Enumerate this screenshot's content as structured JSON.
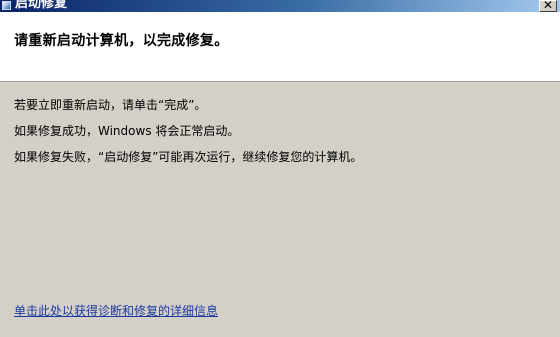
{
  "window": {
    "title": "启动修复",
    "close_glyph": "✕"
  },
  "header": {
    "title": "请重新启动计算机，以完成修复。"
  },
  "body": {
    "lines": [
      "若要立即重新启动，请单击“完成”。",
      "如果修复成功，Windows 将会正常启动。",
      "如果修复失败，“启动修复”可能再次运行，继续修复您的计算机。"
    ]
  },
  "details_link": {
    "label": "单击此处以获得诊断和修复的详细信息"
  },
  "icons": {
    "title_icon": "repair-app-icon"
  },
  "colors": {
    "titlebar_start": "#0a246a",
    "titlebar_end": "#a6caf0",
    "window_bg": "#d4d0c8",
    "header_bg": "#ffffff",
    "link": "#1a3aa0"
  }
}
